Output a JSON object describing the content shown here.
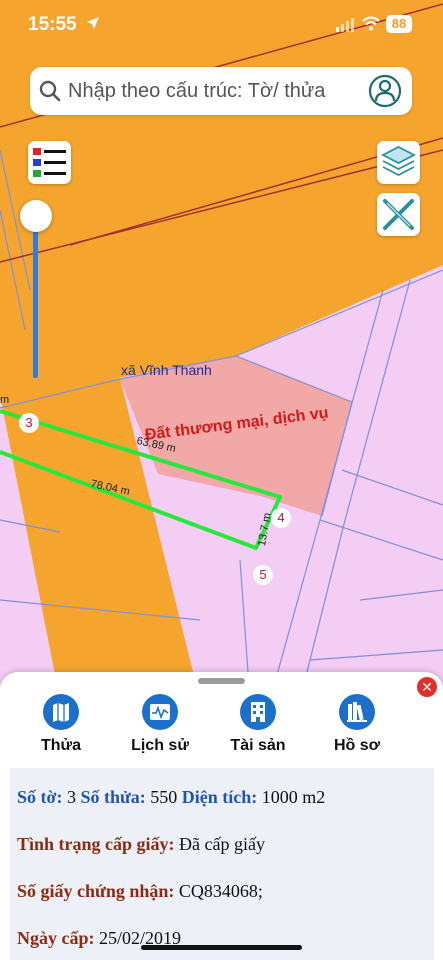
{
  "status_bar": {
    "time": "15:55",
    "battery": "88"
  },
  "search": {
    "placeholder": "Nhập theo cấu trúc: Tờ/ thửa"
  },
  "map": {
    "area_label": "xã Vĩnh Thanh",
    "landuse_label": "Đất thương mại, dịch vụ",
    "dimensions": [
      "63.89 m",
      "78.04 m",
      "13.7 m",
      "m"
    ],
    "vertices": [
      "3",
      "4",
      "5"
    ],
    "colors": {
      "orange": "#f5a52d",
      "pink_zone": "#f4cdf5",
      "commercial": "#f2a8a6",
      "parcel_outline": "#27e63c",
      "road": "#7f8fd8"
    }
  },
  "sheet": {
    "tabs": [
      {
        "label": "Thửa",
        "icon": "map-icon"
      },
      {
        "label": "Lịch sử",
        "icon": "history-chart-icon"
      },
      {
        "label": "Tài sản",
        "icon": "building-icon"
      },
      {
        "label": "Hồ sơ",
        "icon": "documents-icon"
      }
    ],
    "tab_overflow": "H",
    "info": {
      "so_to_label": "Số tờ:",
      "so_to_value": "3",
      "so_thua_label": "Số thửa:",
      "so_thua_value": "550",
      "dien_tich_label": "Diện tích:",
      "dien_tich_value": "1000 m2",
      "tinh_trang_label": "Tình trạng cấp giấy:",
      "tinh_trang_value": "Đã cấp giấy",
      "so_giay_label": "Số giấy chứng nhận:",
      "so_giay_value": "CQ834068;",
      "ngay_cap_label": "Ngày cấp:",
      "ngay_cap_value": "25/02/2019"
    }
  }
}
